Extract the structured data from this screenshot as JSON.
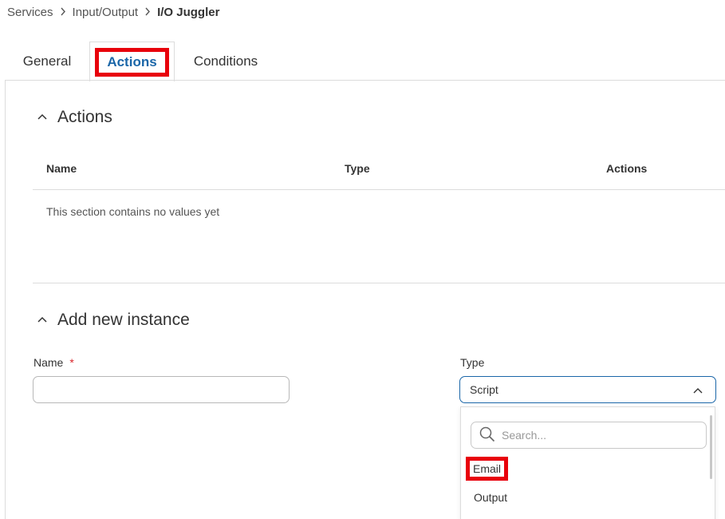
{
  "breadcrumb": {
    "items": [
      "Services",
      "Input/Output"
    ],
    "current": "I/O Juggler"
  },
  "tabs": [
    {
      "label": "General",
      "active": false
    },
    {
      "label": "Actions",
      "active": true
    },
    {
      "label": "Conditions",
      "active": false
    }
  ],
  "actions_section": {
    "title": "Actions",
    "columns": [
      "Name",
      "Type",
      "Actions"
    ],
    "empty_message": "This section contains no values yet"
  },
  "add_instance": {
    "title": "Add new instance",
    "name_label": "Name",
    "required_marker": "*",
    "name_value": "",
    "type_label": "Type",
    "type_value": "Script"
  },
  "type_dropdown": {
    "search_placeholder": "Search...",
    "options": [
      "Email",
      "Output"
    ]
  },
  "colors": {
    "accent": "#1a66a8",
    "highlight": "#e8000b",
    "required": "#d9262c"
  }
}
